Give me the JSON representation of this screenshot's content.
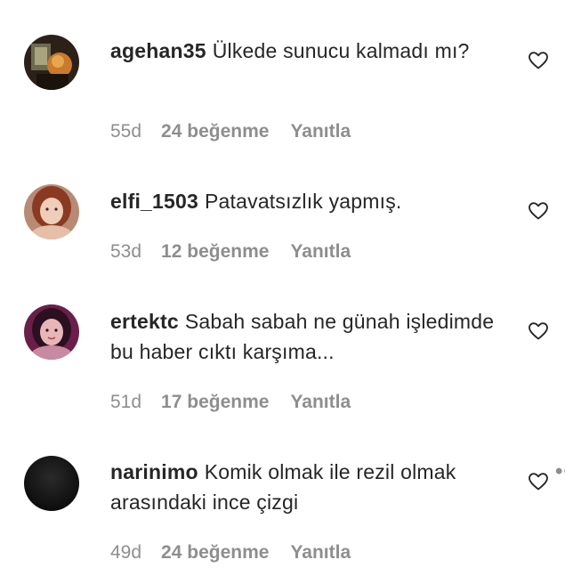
{
  "comments": [
    {
      "username": "agehan35",
      "text": "Ülkede sunucu kalmadı mı?",
      "time": "55d",
      "likes": "24 beğenme",
      "reply_label": "Yanıtla",
      "avatar_icon": "avatar-photo",
      "like_icon": "heart-outline-icon"
    },
    {
      "username": "elfi_1503",
      "text": "Patavatsızlık yapmış.",
      "time": "53d",
      "likes": "12 beğenme",
      "reply_label": "Yanıtla",
      "avatar_icon": "avatar-photo",
      "like_icon": "heart-outline-icon"
    },
    {
      "username": "ertektc",
      "text": "Sabah sabah ne günah işledimde bu haber cıktı karşıma...",
      "time": "51d",
      "likes": "17 beğenme",
      "reply_label": "Yanıtla",
      "avatar_icon": "avatar-photo",
      "like_icon": "heart-outline-icon"
    },
    {
      "username": "narinimo",
      "text": "Komik olmak ile rezil olmak arasındaki ince çizgi",
      "time": "49d",
      "likes": "24 beğenme",
      "reply_label": "Yanıtla",
      "more_label": "•••",
      "avatar_icon": "avatar-photo",
      "like_icon": "heart-outline-icon"
    }
  ],
  "colors": {
    "text": "#262626",
    "secondary": "#8e8e8e",
    "background": "#ffffff"
  }
}
